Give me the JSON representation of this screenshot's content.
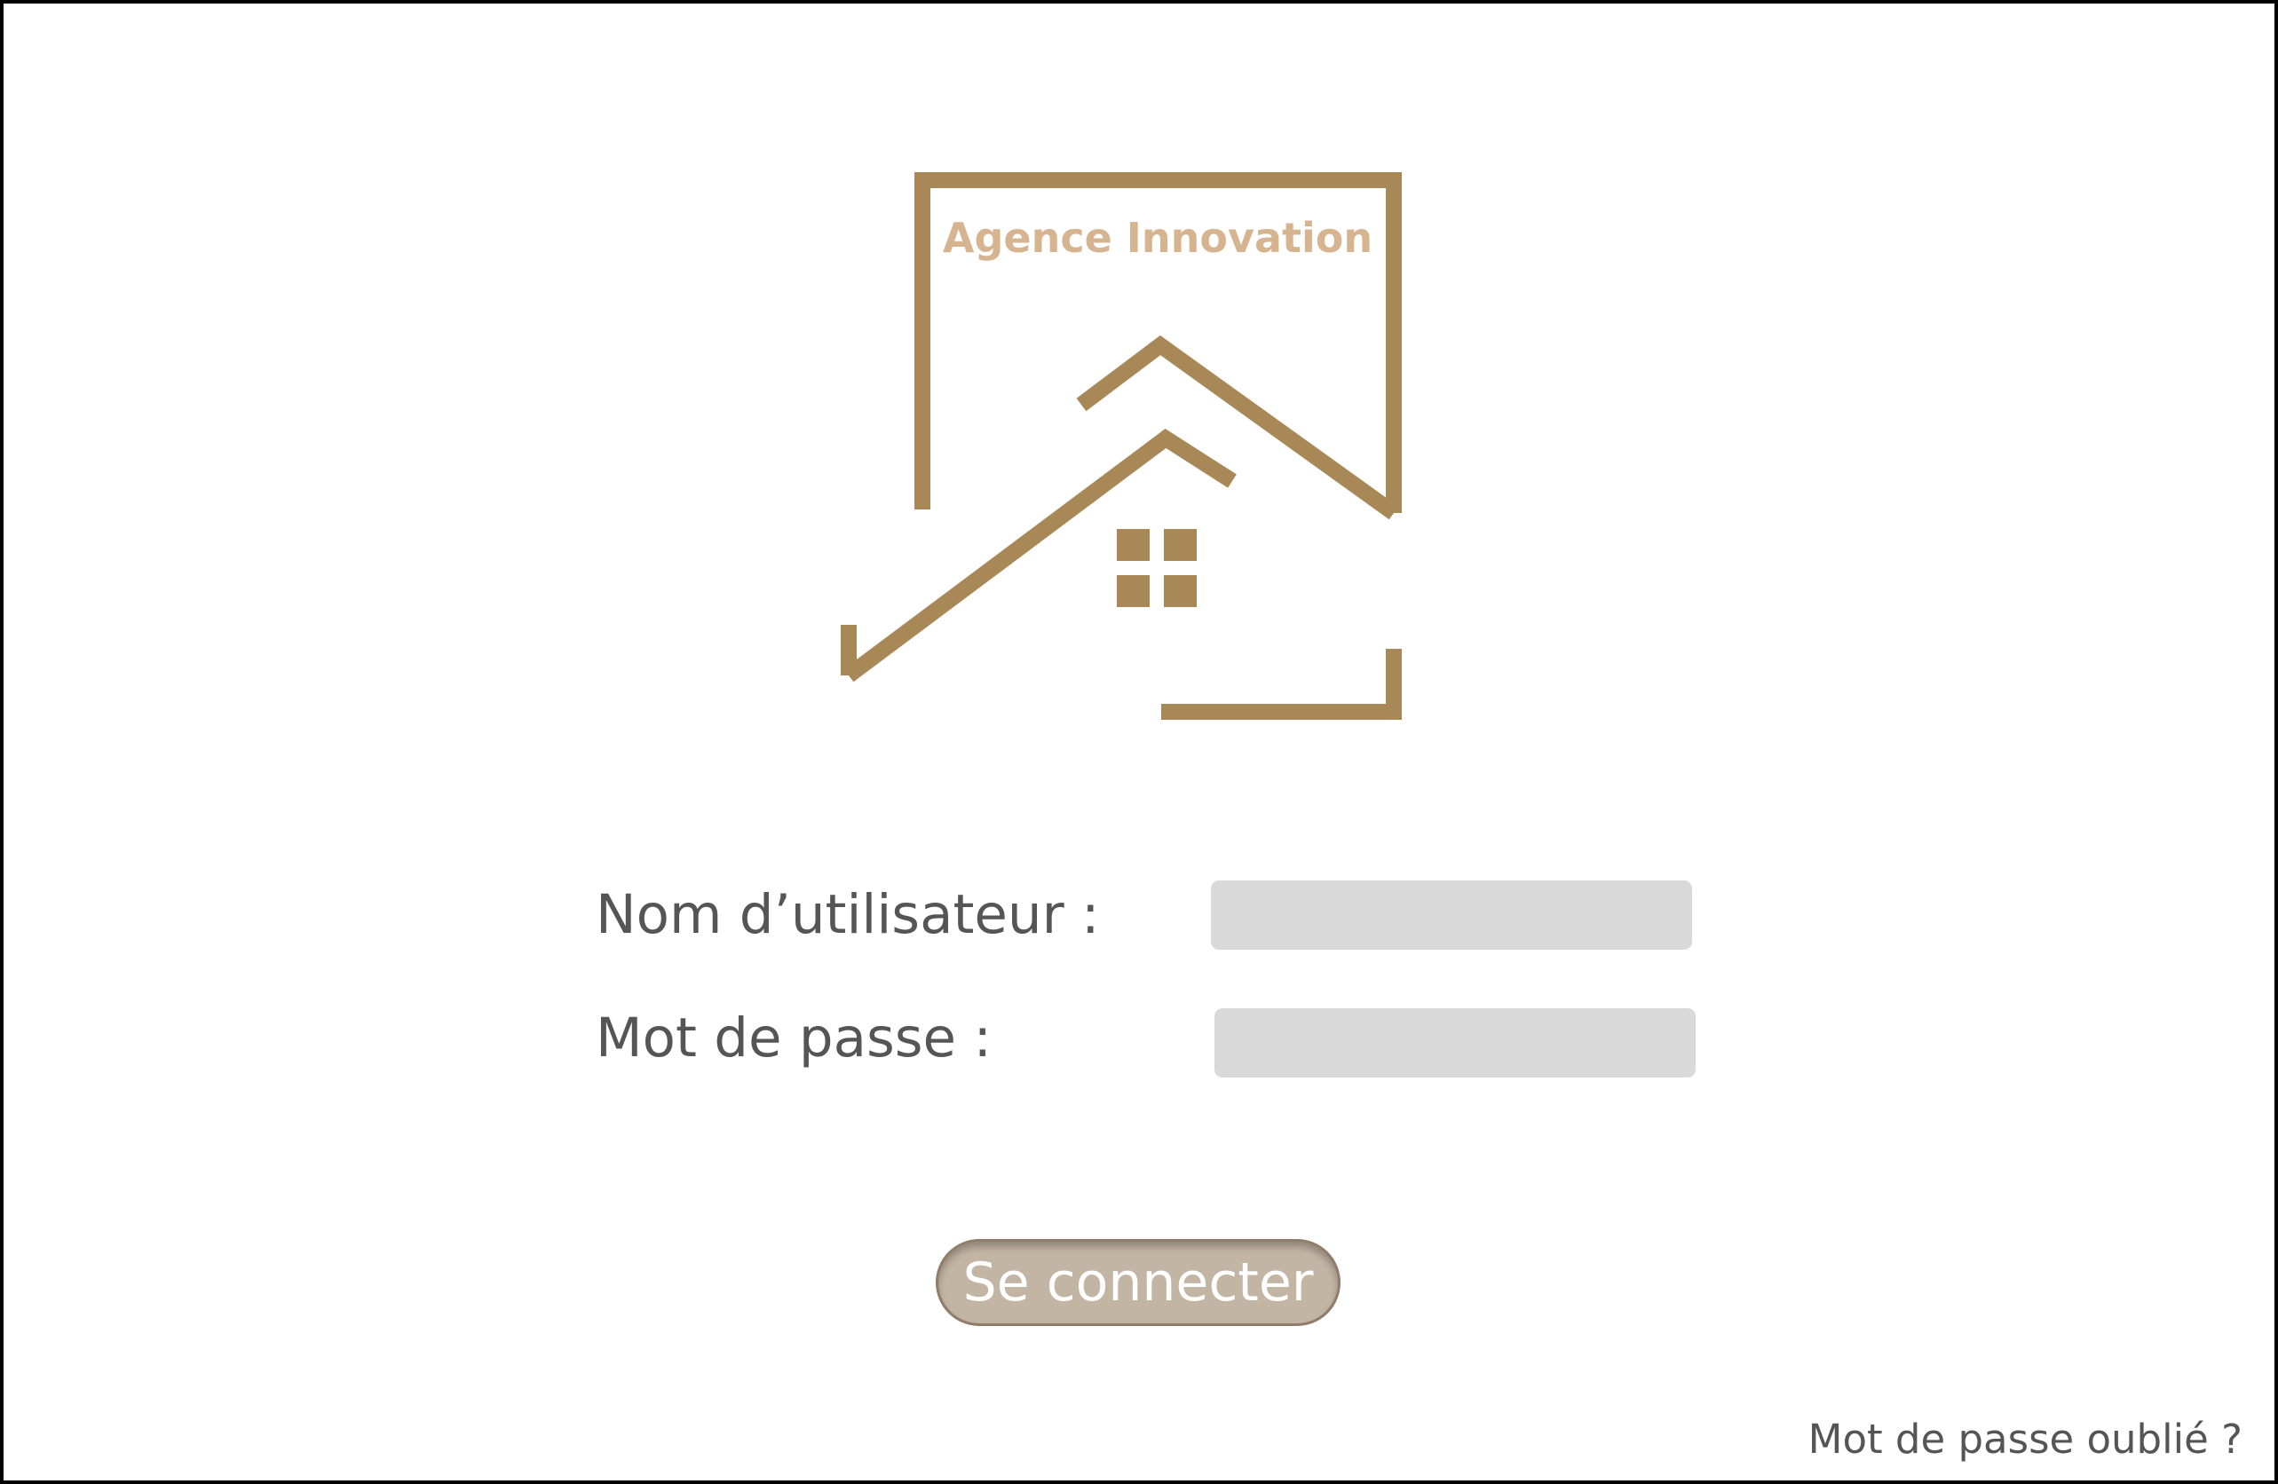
{
  "brand": {
    "name": "Agence Innovation",
    "logo_icon": "house-roof-logo",
    "color": "#a88856",
    "text_color": "#d6b48f"
  },
  "form": {
    "username_label": "Nom d’utilisateur :",
    "username_value": "",
    "password_label": "Mot de passe :",
    "password_value": "",
    "input_background": "#d9d9d9",
    "label_color": "#555555"
  },
  "actions": {
    "login_label": "Se connecter",
    "login_color": "#c3b5a3",
    "forgot_password_label": "Mot de passe oublié ?"
  }
}
